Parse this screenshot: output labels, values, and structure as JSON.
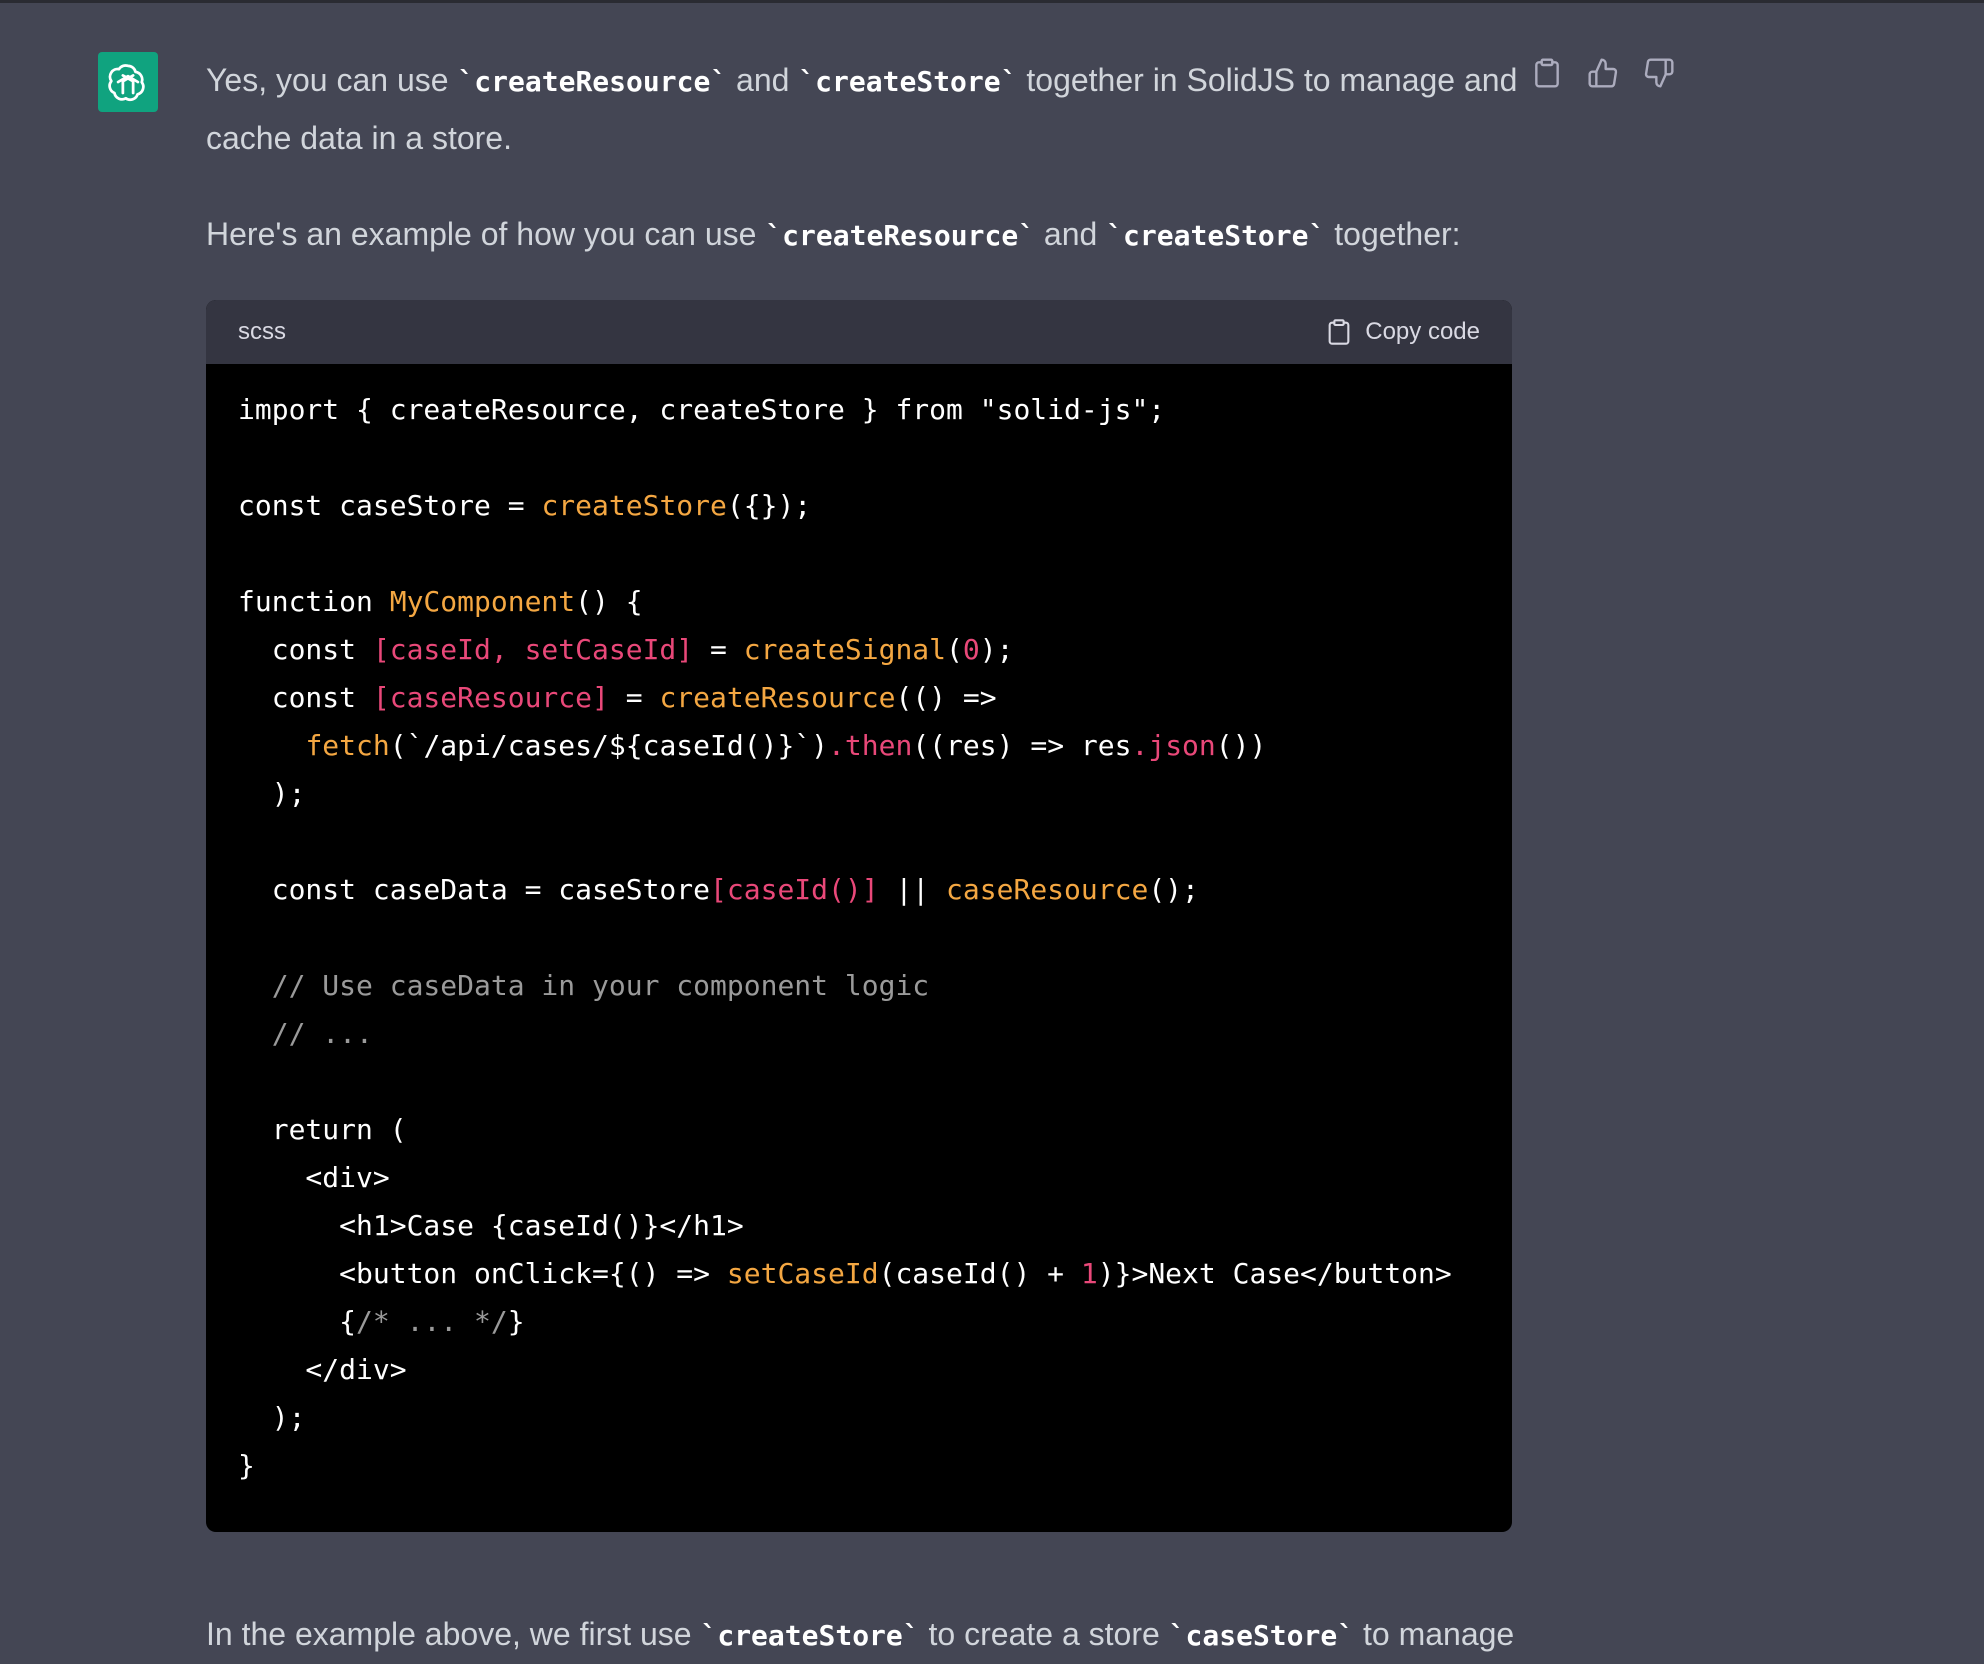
{
  "assistant": {
    "avatar_icon": "openai-logo-icon",
    "avatar_color": "#10a37f"
  },
  "actions": {
    "copy_icon": "clipboard-icon",
    "like_icon": "thumbs-up-icon",
    "dislike_icon": "thumbs-down-icon"
  },
  "message": {
    "p1": {
      "a": "Yes, you can use ",
      "c1": "`createResource`",
      "b": " and ",
      "c2": "`createStore`",
      "c": " together in SolidJS to manage and",
      "d": "cache data in a store."
    },
    "p2": {
      "a": "Here's an example of how you can use ",
      "c1": "`createResource`",
      "b": " and ",
      "c2": "`createStore`",
      "c": " together:"
    },
    "p3": {
      "a": "In the example above, we first use ",
      "c1": "`createStore`",
      "b": " to create a store ",
      "c2": "`caseStore`",
      "c": " to manage"
    }
  },
  "code_block": {
    "language": "scss",
    "copy_label": "Copy code",
    "lines": [
      "import { createResource, createStore } from \"solid-js\";",
      "",
      "const caseStore = createStore({});",
      "",
      "function MyComponent() {",
      "  const [caseId, setCaseId] = createSignal(0);",
      "  const [caseResource] = createResource(() =>",
      "    fetch(`/api/cases/${caseId()}`).then((res) => res.json())",
      "  );",
      "",
      "  const caseData = caseStore[caseId()] || caseResource();",
      "",
      "  // Use caseData in your component logic",
      "  // ...",
      "",
      "  return (",
      "    <div>",
      "      <h1>Case {caseId()}</h1>",
      "      <button onClick={() => setCaseId(caseId() + 1)}>Next Case</button>",
      "      {/* ... */}",
      "    </div>",
      "  );",
      "}"
    ]
  },
  "colors": {
    "background": "#444654",
    "code_background": "#000000",
    "code_header": "#343541",
    "function_name": "#f4a742",
    "variable_pink": "#e94879",
    "comment": "#9a9a9a"
  }
}
